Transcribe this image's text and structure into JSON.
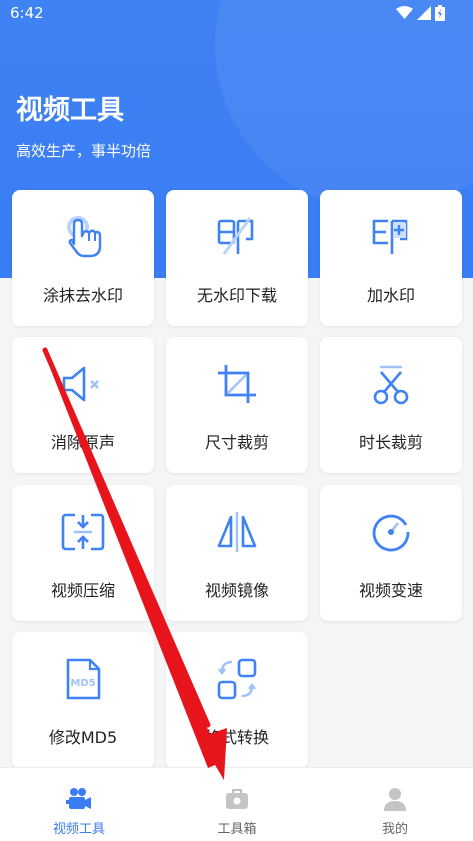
{
  "status_bar": {
    "time": "6:42"
  },
  "header": {
    "title": "视频工具",
    "subtitle": "高效生产，事半功倍"
  },
  "tools": [
    {
      "label": "涂抹去水印",
      "icon": "tap-hand-icon"
    },
    {
      "label": "无水印下载",
      "icon": "no-watermark-icon"
    },
    {
      "label": "加水印",
      "icon": "add-watermark-icon"
    },
    {
      "label": "消除原声",
      "icon": "mute-speaker-icon"
    },
    {
      "label": "尺寸裁剪",
      "icon": "crop-icon"
    },
    {
      "label": "时长裁剪",
      "icon": "scissors-icon"
    },
    {
      "label": "视频压缩",
      "icon": "compress-icon"
    },
    {
      "label": "视频镜像",
      "icon": "mirror-icon"
    },
    {
      "label": "视频变速",
      "icon": "speedometer-icon"
    },
    {
      "label": "修改MD5",
      "icon": "md5-file-icon"
    },
    {
      "label": "格式转换",
      "icon": "convert-format-icon"
    }
  ],
  "tab_bar": {
    "items": [
      {
        "label": "视频工具",
        "icon": "video-camera-icon",
        "active": true
      },
      {
        "label": "工具箱",
        "icon": "toolbox-icon",
        "active": false
      },
      {
        "label": "我的",
        "icon": "person-icon",
        "active": false
      }
    ]
  },
  "colors": {
    "accent": "#3a7cf3",
    "icon_blue": "#3f82f4",
    "annotation_arrow": "#e8141c"
  }
}
